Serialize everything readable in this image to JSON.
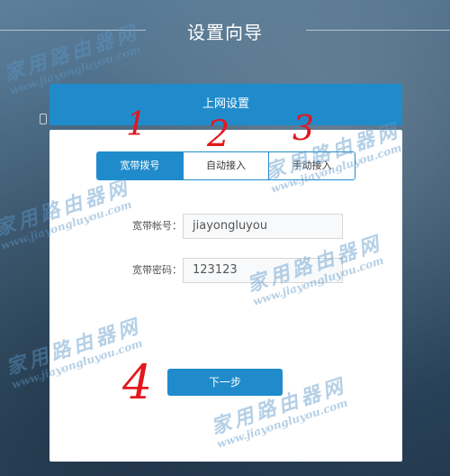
{
  "wizard": {
    "title": "设置向导"
  },
  "header": {
    "title": "上网设置"
  },
  "tabs": [
    {
      "label": "宽带拨号",
      "active": true
    },
    {
      "label": "自动接入",
      "active": false
    },
    {
      "label": "手动接入",
      "active": false
    }
  ],
  "form": {
    "account_label": "宽带帐号：",
    "account_value": "jiayongluyou",
    "password_label": "宽带密码：",
    "password_value": "123123"
  },
  "next_label": "下一步",
  "annotations": [
    "1",
    "2",
    "3",
    "4"
  ],
  "watermark": {
    "cn": "家用路由器网",
    "url": "www.jiayongluyou.com"
  },
  "colors": {
    "accent": "#1f8bcb",
    "annotation": "#e3181f"
  }
}
